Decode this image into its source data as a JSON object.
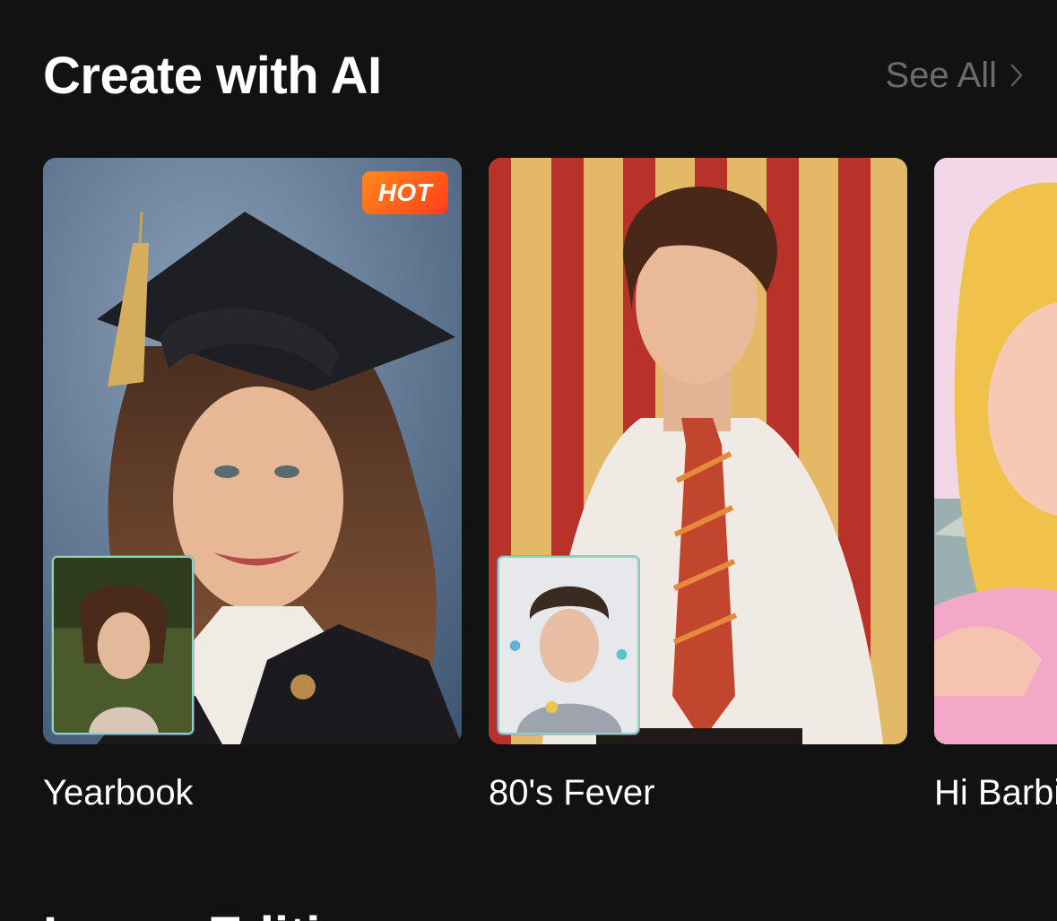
{
  "section": {
    "title": "Create with AI",
    "see_all_label": "See All"
  },
  "cards": [
    {
      "label": "Yearbook",
      "badge": "HOT"
    },
    {
      "label": "80's Fever"
    },
    {
      "label": "Hi Barbi"
    }
  ],
  "next_section": {
    "title": "Image Editing"
  },
  "colors": {
    "background": "#121212",
    "text_primary": "#ffffff",
    "text_secondary": "#6b6b6b",
    "hot_badge": "#ff5a1a"
  }
}
